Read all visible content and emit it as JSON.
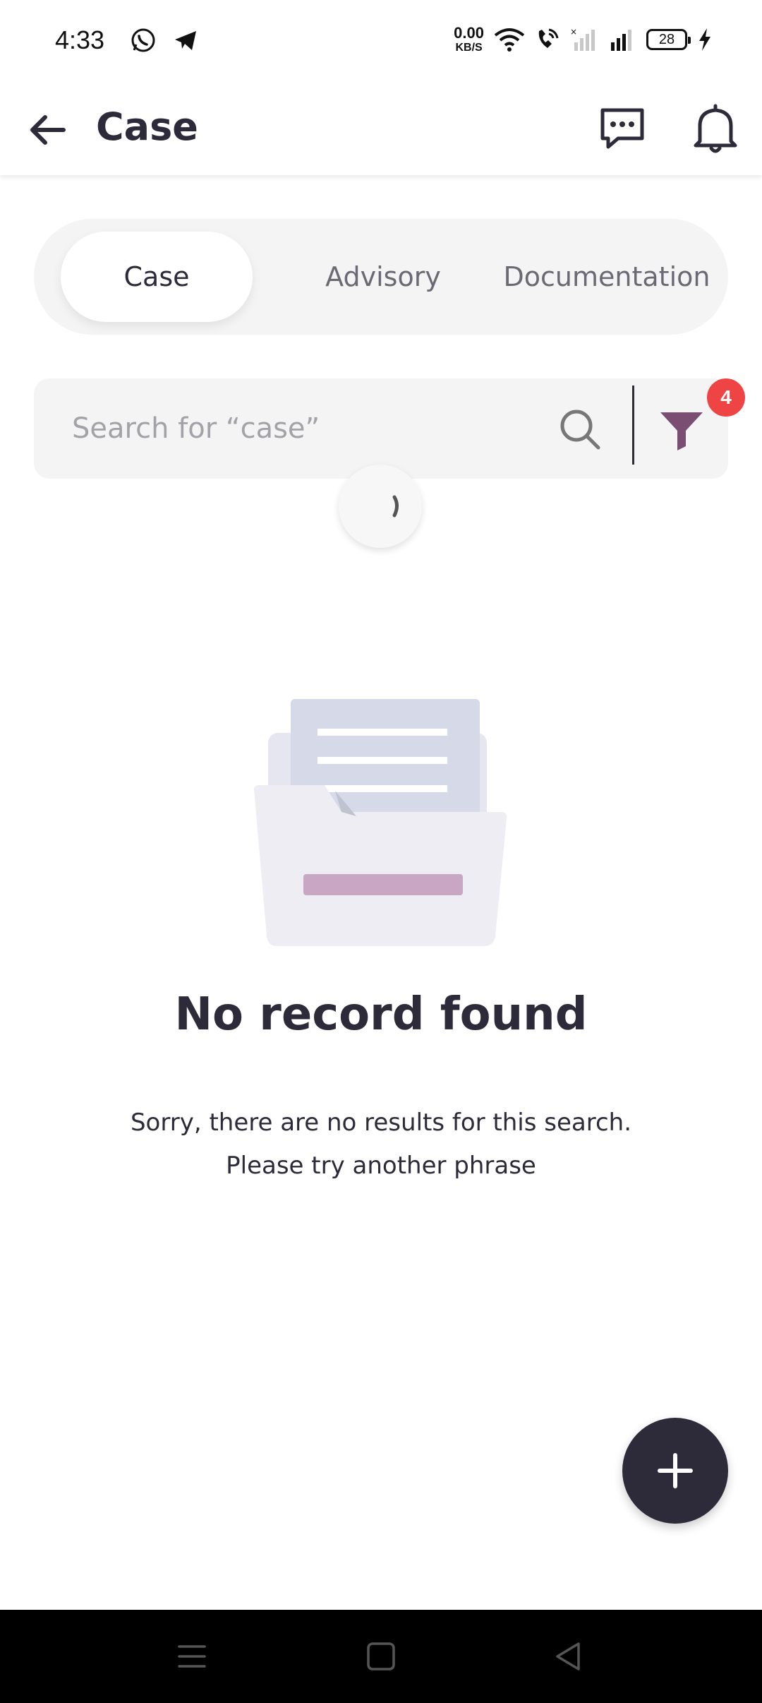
{
  "status_bar": {
    "time": "4:33",
    "net_speed_value": "0.00",
    "net_speed_unit": "KB/S",
    "battery_level": "28",
    "left_icons": [
      "whatsapp-icon",
      "telegram-icon"
    ],
    "right_icons": [
      "wifi-icon",
      "wifi-calling-icon",
      "signal-off-icon",
      "signal-icon",
      "battery-icon",
      "charging-icon"
    ]
  },
  "header": {
    "title": "Case",
    "icons": [
      "back-arrow-icon",
      "chat-icon",
      "bell-icon"
    ]
  },
  "tabs": [
    {
      "label": "Case",
      "active": true
    },
    {
      "label": "Advisory",
      "active": false
    },
    {
      "label": "Documentation",
      "active": false
    }
  ],
  "search": {
    "placeholder": "Search for “case”",
    "filter_count": "4"
  },
  "empty_state": {
    "title": "No record found",
    "message_line1": "Sorry, there are no results for this search.",
    "message_line2": "Please try another phrase"
  },
  "fab": {
    "icon": "plus-icon"
  },
  "nav_bar": {
    "icons": [
      "recents-icon",
      "home-icon",
      "back-icon"
    ]
  },
  "colors": {
    "primary_dark": "#2d2b3a",
    "filter_accent": "#7a4e73",
    "badge_red": "#ee4444",
    "surface_gray": "#f4f4f5"
  }
}
